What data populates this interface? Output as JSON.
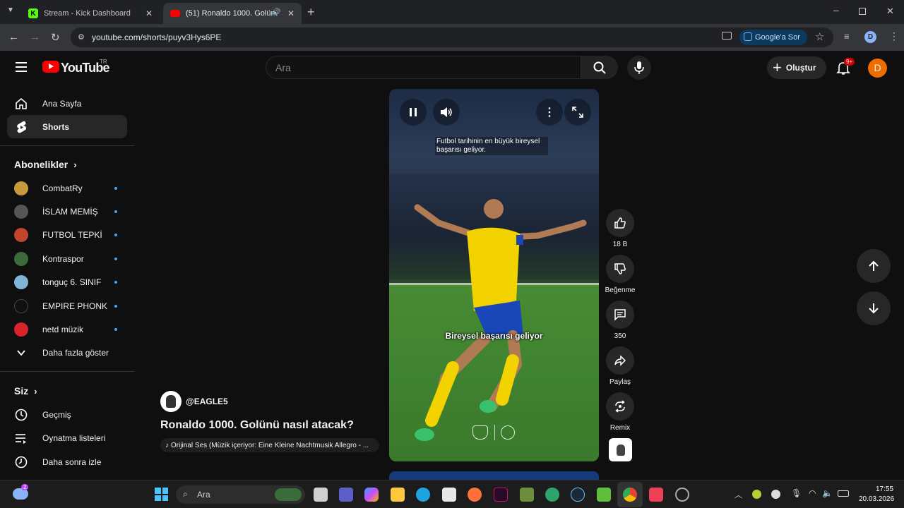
{
  "browser": {
    "tabs": [
      {
        "title": "Stream - Kick Dashboard",
        "favicon": "kick-icon",
        "active": false
      },
      {
        "title": "(51) Ronaldo 1000. Golünü",
        "favicon": "youtube-icon",
        "active": true
      }
    ],
    "url": "youtube.com/shorts/puyv3Hys6PE",
    "google_ask_label": "Google'a Sor"
  },
  "header": {
    "logo_text": "YouTube",
    "logo_region": "TR",
    "search_placeholder": "Ara",
    "create_label": "Oluştur",
    "notifications_badge": "9+",
    "avatar_letter": "D"
  },
  "sidebar": {
    "main": [
      {
        "label": "Ana Sayfa",
        "icon": "home-icon"
      },
      {
        "label": "Shorts",
        "icon": "shorts-icon",
        "selected": true
      }
    ],
    "subs_title": "Abonelikler",
    "subscriptions": [
      {
        "name": "CombatRy",
        "color": "#c99a3c"
      },
      {
        "name": "İSLAM MEMİŞ",
        "color": "#555555"
      },
      {
        "name": "FUTBOL TEPKİ",
        "color": "#c2452d"
      },
      {
        "name": "Kontraspor",
        "color": "#3b6b3a"
      },
      {
        "name": "tonguç 6. SINIF",
        "color": "#7fb6d6"
      },
      {
        "name": "EMPIRE PHONK",
        "color": "#111111"
      },
      {
        "name": "netd müzik",
        "color": "#d8232a"
      }
    ],
    "show_more": "Daha fazla göster",
    "you_title": "Siz",
    "you_items": [
      {
        "label": "Geçmiş",
        "icon": "history-icon"
      },
      {
        "label": "Oynatma listeleri",
        "icon": "playlists-icon"
      },
      {
        "label": "Daha sonra izle",
        "icon": "watch-later-icon"
      }
    ]
  },
  "short": {
    "caption_top": "Futbol tarihinin en büyük bireysel başarısı geliyor.",
    "caption_mid": "Bireysel başarısı geliyor",
    "channel": "@EAGLE5",
    "title": "Ronaldo 1000. Golünü nasıl atacak?",
    "audio": "Orijinal Ses (Müzik içeriyor: Eine Kleine Nachtmusik Allegro - ..."
  },
  "actions": [
    {
      "label": "18 B",
      "icon": "thumbs-up-icon"
    },
    {
      "label": "Beğenme",
      "icon": "thumbs-down-icon"
    },
    {
      "label": "350",
      "icon": "comment-icon"
    },
    {
      "label": "Paylaş",
      "icon": "share-icon"
    },
    {
      "label": "Remix",
      "icon": "remix-icon"
    }
  ],
  "taskbar": {
    "search_label": "Ara",
    "time": "17:55",
    "date": "20.03.2026",
    "weather_badge": "2"
  }
}
